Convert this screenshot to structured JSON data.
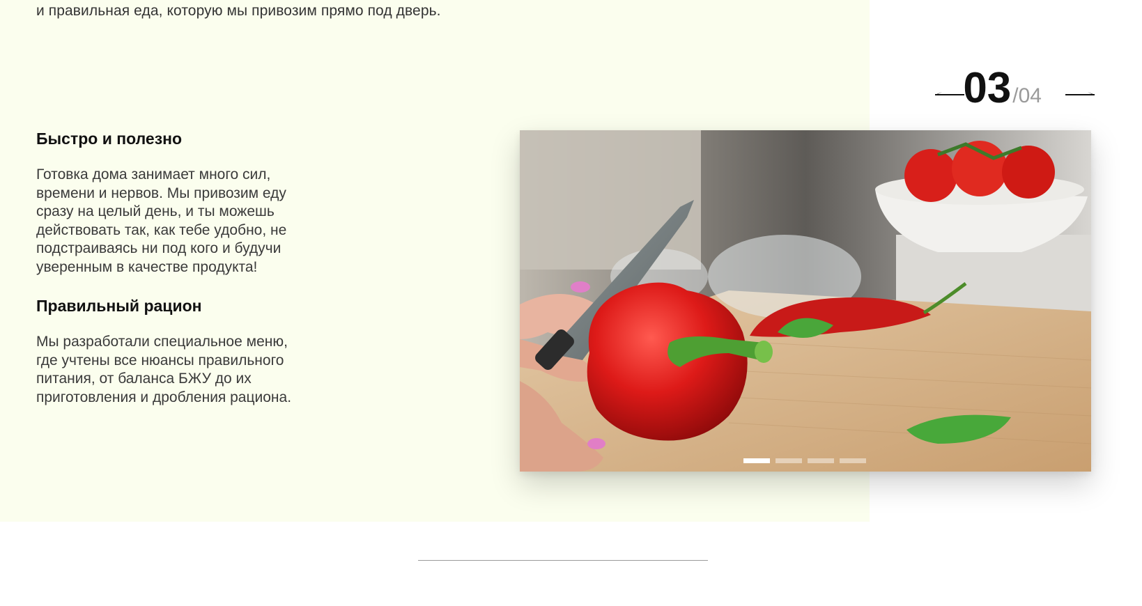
{
  "intro": {
    "line": "и правильная еда, которую мы привозим прямо под дверь."
  },
  "features": [
    {
      "title": "Быстро и полезно",
      "lines": [
        "Готовка дома занимает много сил,",
        "времени и нервов. Мы привозим еду",
        "сразу на целый день, и ты можешь",
        "действовать так, как тебе удобно, не",
        "подстраиваясь ни под кого и будучи",
        "уверенным в качестве продукта!"
      ]
    },
    {
      "title": "Правильный рацион",
      "lines": [
        "Мы разработали специальное меню,",
        "где учтены все нюансы правильного",
        "питания, от баланса БЖУ до их",
        "приготовления и дробления рациона."
      ]
    }
  ],
  "slider": {
    "current": "03",
    "total": "/04",
    "dots_count": 4,
    "active_dot": 0,
    "prev_icon": "arrow-left-icon",
    "next_icon": "arrow-right-icon"
  },
  "colors": {
    "panel_bg": "#fbfeee",
    "accent_pepper": "#d9181c",
    "divider": "#9a9a9a"
  }
}
